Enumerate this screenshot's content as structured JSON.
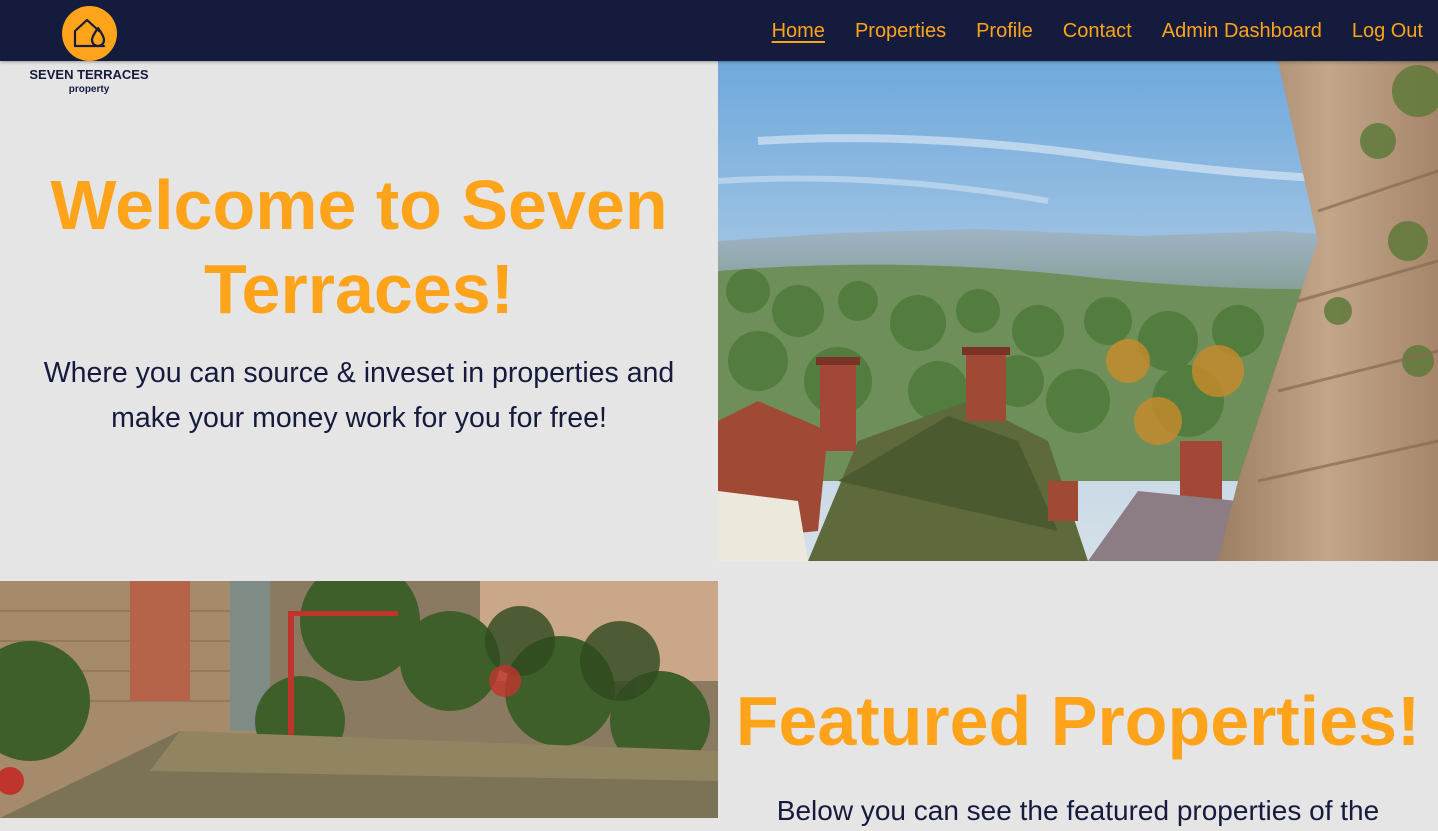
{
  "brand": {
    "name": "SEVEN TERRACES",
    "sub": "property",
    "icon": "house-drop-icon",
    "accent": "#ffa31a",
    "navy": "#141b3d"
  },
  "nav": {
    "items": [
      {
        "label": "Home",
        "active": true
      },
      {
        "label": "Properties",
        "active": false
      },
      {
        "label": "Profile",
        "active": false
      },
      {
        "label": "Contact",
        "active": false
      },
      {
        "label": "Admin Dashboard",
        "active": false
      },
      {
        "label": "Log Out",
        "active": false
      }
    ]
  },
  "hero": {
    "title_line1": "Welcome to Seven",
    "title_line2": "Terraces!",
    "text_line1": "Where you can source & inveset in properties and",
    "text_line2": "make your money work for you for free!"
  },
  "featured": {
    "title": "Featured Properties!",
    "text": "Below you can see the featured properties of the"
  }
}
